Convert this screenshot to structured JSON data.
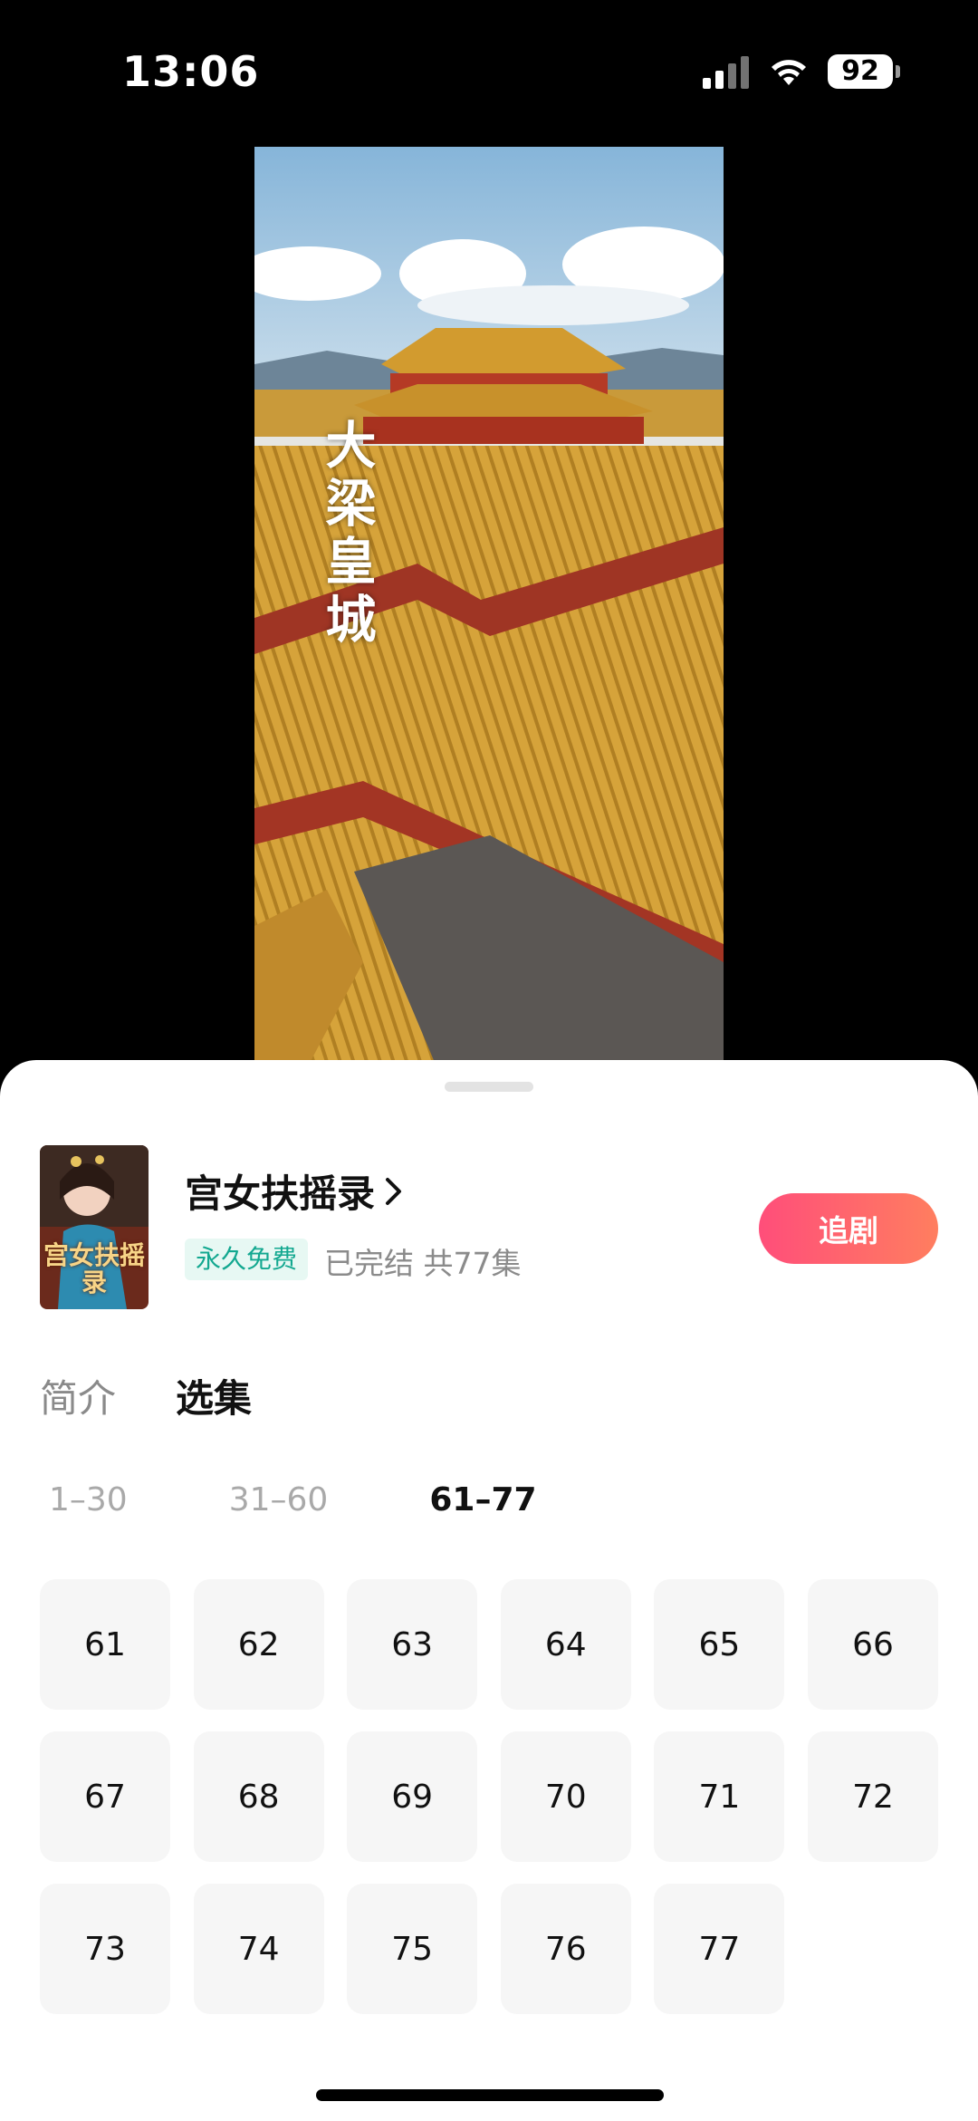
{
  "status_bar": {
    "time": "13:06",
    "battery": "92"
  },
  "video": {
    "overlay_title": "大梁皇城"
  },
  "show": {
    "title": "宫女扶摇录",
    "poster_text": "宫女扶摇录",
    "tag": "永久免费",
    "status": "已完结 共77集",
    "follow_label": "追剧"
  },
  "tabs": [
    {
      "label": "简介",
      "active": false
    },
    {
      "label": "选集",
      "active": true
    }
  ],
  "ranges": [
    {
      "label": "1–30",
      "active": false
    },
    {
      "label": "31–60",
      "active": false
    },
    {
      "label": "61–77",
      "active": true
    }
  ],
  "episodes": [
    "61",
    "62",
    "63",
    "64",
    "65",
    "66",
    "67",
    "68",
    "69",
    "70",
    "71",
    "72",
    "73",
    "74",
    "75",
    "76",
    "77"
  ],
  "colors": {
    "accent_start": "#ff4e7a",
    "accent_end": "#ff7e5f",
    "free_tag": "#13a890"
  }
}
